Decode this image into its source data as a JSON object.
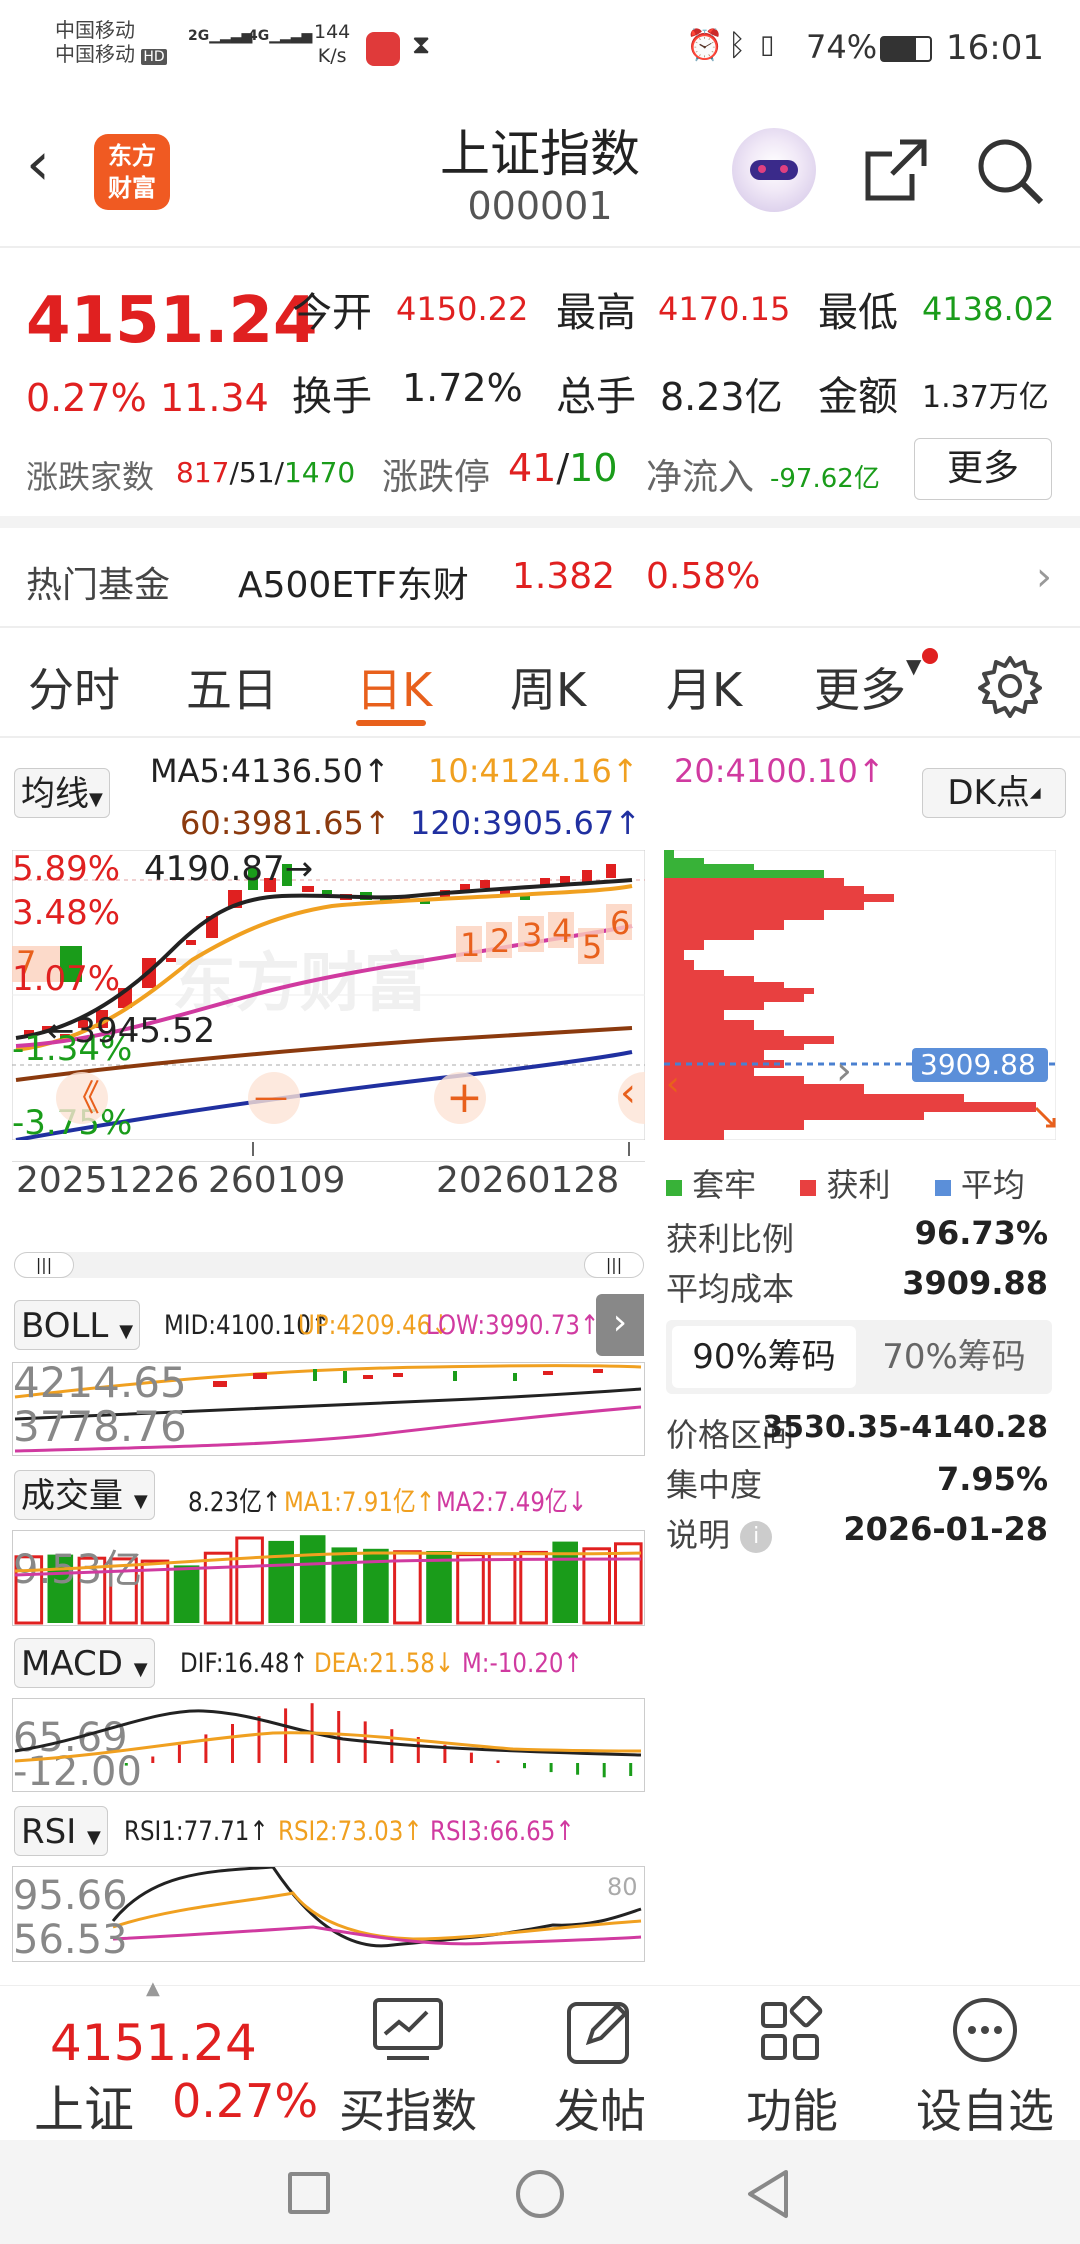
{
  "status_bar": {
    "carrier1": "中国移动",
    "carrier2": "中国移动",
    "hd": "HD",
    "net1": "2G",
    "net2": "4G",
    "speed_value": "144",
    "speed_unit": "K/s",
    "battery": "74%",
    "time": "16:01"
  },
  "header": {
    "logo_line1": "东方",
    "logo_line2": "财富",
    "title": "上证指数",
    "code": "000001"
  },
  "quote": {
    "price": "4151.24",
    "change_pct": "0.27%",
    "change": "11.34",
    "open_label": "今开",
    "open": "4150.22",
    "high_label": "最高",
    "high": "4170.15",
    "low_label": "最低",
    "low": "4138.02",
    "turnover_label": "换手",
    "turnover": "1.72%",
    "volume_label": "总手",
    "volume": "8.23亿",
    "amount_label": "金额",
    "amount": "1.37万亿",
    "breadth_label": "涨跌家数",
    "breadth_up": "817",
    "breadth_flat": "51",
    "breadth_down": "1470",
    "sep": "/",
    "limit_label": "涨跌停",
    "limit_up": "41",
    "limit_down": "10",
    "netflow_label": "净流入",
    "netflow": "-97.62亿",
    "more_button": "更多"
  },
  "fund": {
    "label": "热门基金",
    "name": "A500ETF东财",
    "price": "1.382",
    "pct": "0.58%"
  },
  "tabs": [
    {
      "label": "分时"
    },
    {
      "label": "五日"
    },
    {
      "label": "日K"
    },
    {
      "label": "周K"
    },
    {
      "label": "月K"
    },
    {
      "label": "更多"
    }
  ],
  "ma": {
    "selector": "均线",
    "ma5": "MA5:4136.50↑",
    "ma10": "10:4124.16↑",
    "ma20": "20:4100.10↑",
    "ma60": "60:3981.65↑",
    "ma120": "120:3905.67↑",
    "dk_button": "DK点"
  },
  "kline": {
    "pct_labels": [
      "5.89%",
      "3.48%",
      "1.07%",
      "-1.34%",
      "-3.75%"
    ],
    "high_mark": "4190.87",
    "low_mark": "3945.52",
    "date_start": "20251226",
    "date_mid": "260109",
    "date_end": "20260128",
    "signals": [
      "1",
      "2",
      "3",
      "4",
      "5",
      "6"
    ],
    "watermark": "东方财富",
    "nav_prev": "《",
    "minus": "—",
    "plus": "+",
    "scroll_handle": "|||",
    "left_signal": "7"
  },
  "boll": {
    "selector": "BOLL",
    "mid": "MID:4100.10↑",
    "up": "UP:4209.46↓",
    "low": "LOW:3990.73↑",
    "ytop": "4214.65",
    "ybot": "3778.76"
  },
  "vol": {
    "selector": "成交量",
    "v": "8.23亿↑",
    "ma1": "MA1:7.91亿↑",
    "ma2": "MA2:7.49亿↓",
    "ytop": "9.53亿",
    "bars": [
      {
        "v": 9.2,
        "c": "r"
      },
      {
        "v": 9.5,
        "c": "g"
      },
      {
        "v": 9.0,
        "c": "r"
      },
      {
        "v": 8.9,
        "c": "r"
      },
      {
        "v": 8.6,
        "c": "r"
      },
      {
        "v": 8.0,
        "c": "g"
      },
      {
        "v": 9.7,
        "c": "r"
      },
      {
        "v": 11.8,
        "c": "r"
      },
      {
        "v": 11.4,
        "c": "g"
      },
      {
        "v": 12.2,
        "c": "g"
      },
      {
        "v": 10.5,
        "c": "g"
      },
      {
        "v": 10.3,
        "c": "g"
      },
      {
        "v": 9.9,
        "c": "r"
      },
      {
        "v": 10.0,
        "c": "g"
      },
      {
        "v": 9.5,
        "c": "r"
      },
      {
        "v": 9.6,
        "c": "r"
      },
      {
        "v": 9.8,
        "c": "r"
      },
      {
        "v": 11.3,
        "c": "g"
      },
      {
        "v": 10.3,
        "c": "r"
      },
      {
        "v": 11.0,
        "c": "r"
      }
    ]
  },
  "macd": {
    "selector": "MACD",
    "dif": "DIF:16.48↑",
    "dea": "DEA:21.58↓",
    "m": "M:-10.20↑",
    "ytop": "65.69",
    "ybot": "-12.00",
    "hist": [
      -2,
      5,
      14,
      22,
      30,
      36,
      42,
      46,
      40,
      32,
      26,
      20,
      14,
      8,
      2,
      -4,
      -7,
      -9,
      -11,
      -10
    ]
  },
  "rsi": {
    "selector": "RSI",
    "r1": "RSI1:77.71↑",
    "r2": "RSI2:73.03↑",
    "r3": "RSI3:66.65↑",
    "ytop": "95.66",
    "ybot": "56.53",
    "ref": "80"
  },
  "chips": {
    "cost_label": "3909.88",
    "legend": [
      "套牢",
      "获利",
      "平均"
    ],
    "profit_label": "获利比例",
    "profit": "96.73%",
    "avg_label": "平均成本",
    "avg": "3909.88",
    "tab90": "90%筹码",
    "tab70": "70%筹码",
    "range_label": "价格区间",
    "range": "3530.35-4140.28",
    "conc_label": "集中度",
    "conc": "7.95%",
    "note_label": "说明",
    "date": "2026-01-28"
  },
  "bottom_nav": {
    "price": "4151.24",
    "name": "上证",
    "pct": "0.27%",
    "items": [
      "买指数",
      "发帖",
      "功能",
      "设自选"
    ]
  },
  "colors": {
    "up": "#e02020",
    "down": "#1a9c1a",
    "accent": "#e8601c",
    "ma10": "#f0a020",
    "ma20": "#d03aa0",
    "ma60": "#8b3a0e",
    "ma120": "#2030a0"
  }
}
